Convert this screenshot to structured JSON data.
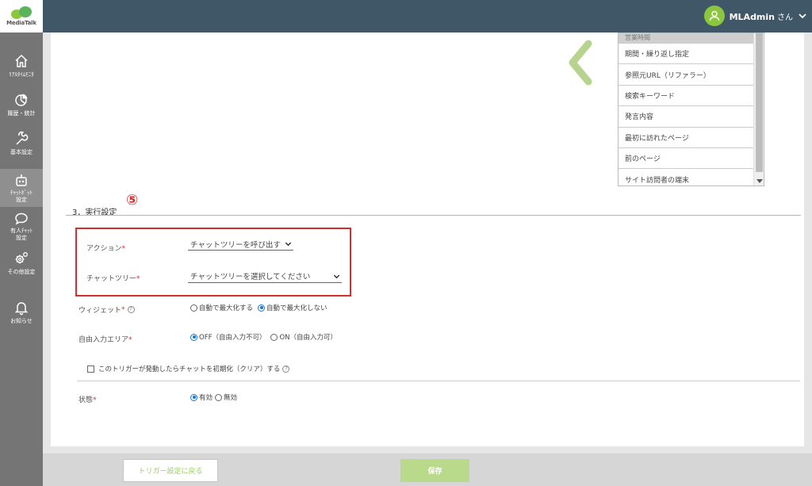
{
  "brand": {
    "logo_text": "MediaTalk",
    "accent": "#8cc63f",
    "header_bg": "#3f5766",
    "sidebar_bg": "#757575",
    "alert_red": "#d32f2f"
  },
  "user": {
    "name": "MLAdmin",
    "suffix": "さん",
    "icon": "user-icon",
    "menu_icon": "chevron-down-icon"
  },
  "sidebar": {
    "items": [
      {
        "label": "ﾘｱﾙﾀｲﾑﾓﾆﾀ",
        "icon": "home-icon"
      },
      {
        "label": "履歴・統計",
        "icon": "pie-chart-icon"
      },
      {
        "label": "基本設定",
        "icon": "wrench-icon"
      },
      {
        "label_line1": "ﾁｬｯﾄﾎﾞｯﾄ",
        "label_line2": "設定",
        "icon": "robot-icon",
        "active": true
      },
      {
        "label_line1": "有人ﾁｬｯﾄ",
        "label_line2": "設定",
        "icon": "chat-bubble-icon"
      },
      {
        "label": "その他設定",
        "icon": "gears-icon"
      },
      {
        "label": "お知らせ",
        "icon": "bell-icon"
      }
    ]
  },
  "variables": {
    "items": [
      "営業時間",
      "期間・繰り返し指定",
      "参照元URL（リファラー）",
      "検索キーワード",
      "発言内容",
      "最初に訪れたページ",
      "前のページ",
      "サイト訪問者の端末"
    ]
  },
  "section": {
    "title": "3．実行設定",
    "badge": "⑤"
  },
  "form": {
    "action": {
      "label": "アクション",
      "required": "*",
      "value": "チャットツリーを呼び出す"
    },
    "chat_tree": {
      "label": "チャットツリー",
      "required": "*",
      "value": "チャットツリーを選択してください"
    },
    "widget": {
      "label": "ウィジェット",
      "required": "*",
      "help": "?",
      "options": [
        "自動で最大化する",
        "自動で最大化しない"
      ],
      "selected": 1
    },
    "free_input": {
      "label": "自由入力エリア",
      "required": "*",
      "options": [
        "OFF（自由入力不可）",
        "ON（自由入力可）"
      ],
      "selected": 0
    },
    "reset_checkbox": {
      "label": "このトリガーが発動したらチャットを初期化（クリア）する",
      "help": "?",
      "checked": false
    },
    "status": {
      "label": "状態",
      "required": "*",
      "options": [
        "有効",
        "無効"
      ],
      "selected": 0
    }
  },
  "footer": {
    "back_label": "トリガー設定に戻る",
    "save_label": "保存"
  }
}
